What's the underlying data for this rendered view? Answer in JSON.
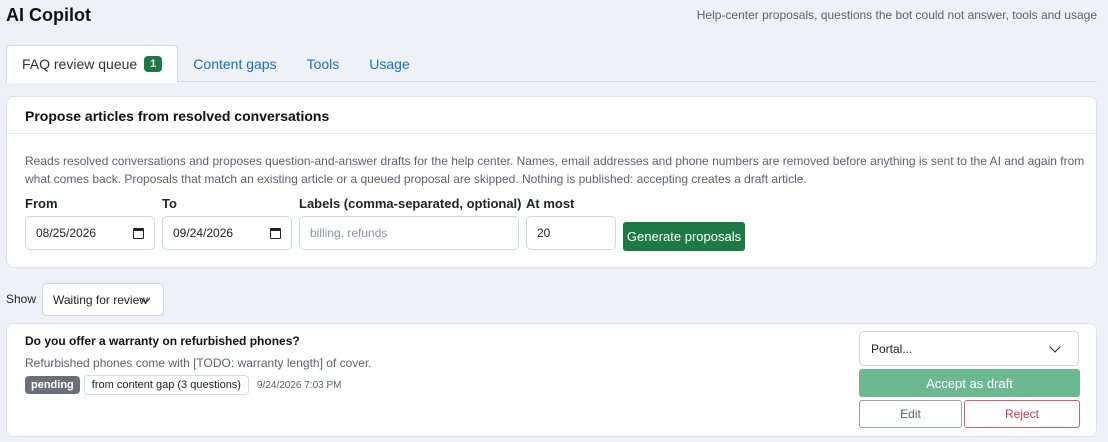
{
  "header": {
    "title": "AI Copilot",
    "subtitle": "Help-center proposals, questions the bot could not answer, tools and usage"
  },
  "tabs": [
    {
      "label": "FAQ review queue",
      "badge": "1",
      "active": true
    },
    {
      "label": "Content gaps",
      "active": false
    },
    {
      "label": "Tools",
      "active": false
    },
    {
      "label": "Usage",
      "active": false
    }
  ],
  "propose": {
    "title": "Propose articles from resolved conversations",
    "description": "Reads resolved conversations and proposes question-and-answer drafts for the help center. Names, email addresses and phone numbers are removed before anything is sent to the AI and again from what comes back. Proposals that match an existing article or a queued proposal are skipped. Nothing is published: accepting creates a draft article.",
    "from_label": "From",
    "from_value": "08/25/2026",
    "to_label": "To",
    "to_value": "09/24/2026",
    "labels_label": "Labels (comma-separated, optional)",
    "labels_placeholder": "billing, refunds",
    "at_most_label": "At most",
    "at_most_value": "20",
    "generate_label": "Generate proposals"
  },
  "filter": {
    "show_label": "Show",
    "show_value": "Waiting for review"
  },
  "proposals": [
    {
      "question": "Do you offer a warranty on refurbished phones?",
      "answer": "Refurbished phones come with [TODO: warranty length] of cover.",
      "status": "pending",
      "source": "from content gap (3 questions)",
      "timestamp": "9/24/2026 7:03 PM",
      "portal_value": "Portal...",
      "accept_label": "Accept as draft",
      "edit_label": "Edit",
      "reject_label": "Reject"
    }
  ],
  "colors": {
    "accent_green": "#1e7a44",
    "accept_green_disabled": "#6cb890",
    "link_blue": "#1a6fc4",
    "reject_red": "#c93a46"
  }
}
